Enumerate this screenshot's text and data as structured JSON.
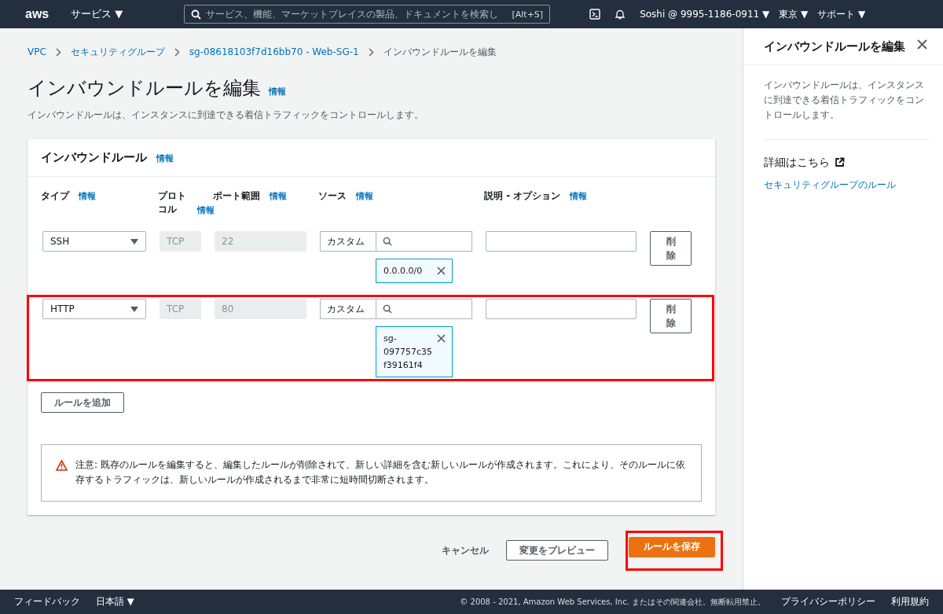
{
  "top_nav": {
    "logo": "aws",
    "services": "サービス ▼",
    "search": {
      "placeholder": "サービス、機能、マーケットプレイスの製品、ドキュメントを検索し",
      "shortcut": "[Alt+S]"
    },
    "account": "Soshi @ 9995-1186-0911 ▼",
    "region": "東京 ▼",
    "support": "サポート ▼"
  },
  "breadcrumbs": [
    {
      "label": "VPC",
      "link": true
    },
    {
      "label": "セキュリティグループ",
      "link": true
    },
    {
      "label": "sg-08618103f7d16bb70 - Web-SG-1",
      "link": true
    },
    {
      "label": "インバウンドルールを編集",
      "link": false
    }
  ],
  "page": {
    "title": "インバウンドルールを編集",
    "info": "情報",
    "description": "インバウンドルールは、インスタンスに到達できる着信トラフィックをコントロールします。"
  },
  "panel": {
    "title": "インバウンドルール",
    "info": "情報",
    "columns": [
      {
        "label": "タイプ",
        "info": "情報"
      },
      {
        "label": "プロトコル",
        "info": "情報"
      },
      {
        "label": "ポート範囲",
        "info": "情報"
      },
      {
        "label": "ソース",
        "info": "情報"
      },
      {
        "label": "説明 - オプション",
        "info": "情報"
      }
    ],
    "rules": [
      {
        "type": "SSH",
        "protocol": "TCP",
        "port": "22",
        "source": "カスタム",
        "token": "0.0.0.0/0",
        "delete": "削除",
        "highlighted": false
      },
      {
        "type": "HTTP",
        "protocol": "TCP",
        "port": "80",
        "source": "カスタム",
        "token": "sg-097757c35f39161f4",
        "delete": "削除",
        "highlighted": true
      }
    ],
    "add_rule": "ルールを追加",
    "warning": "注意: 既存のルールを編集すると、編集したルールが削除されて、新しい詳細を含む新しいルールが作成されます。これにより、そのルールに依存するトラフィックは、新しいルールが作成されるまで非常に短時間切断されます。"
  },
  "actions": {
    "cancel": "キャンセル",
    "preview": "変更をプレビュー",
    "save": "ルールを保存",
    "save_highlighted": true
  },
  "help_panel": {
    "title": "インバウンドルールを編集",
    "text": "インバウンドルールは、インスタンスに到達できる着信トラフィックをコントロールします。",
    "learn_more": "詳細はこちら",
    "link": "セキュリティグループのルール"
  },
  "footer": {
    "feedback": "フィードバック",
    "language": "日本語 ▼",
    "copyright": "© 2008 - 2021, Amazon Web Services, Inc. またはその関連会社。無断転用禁止。",
    "privacy": "プライバシーポリシー",
    "terms": "利用規約"
  }
}
